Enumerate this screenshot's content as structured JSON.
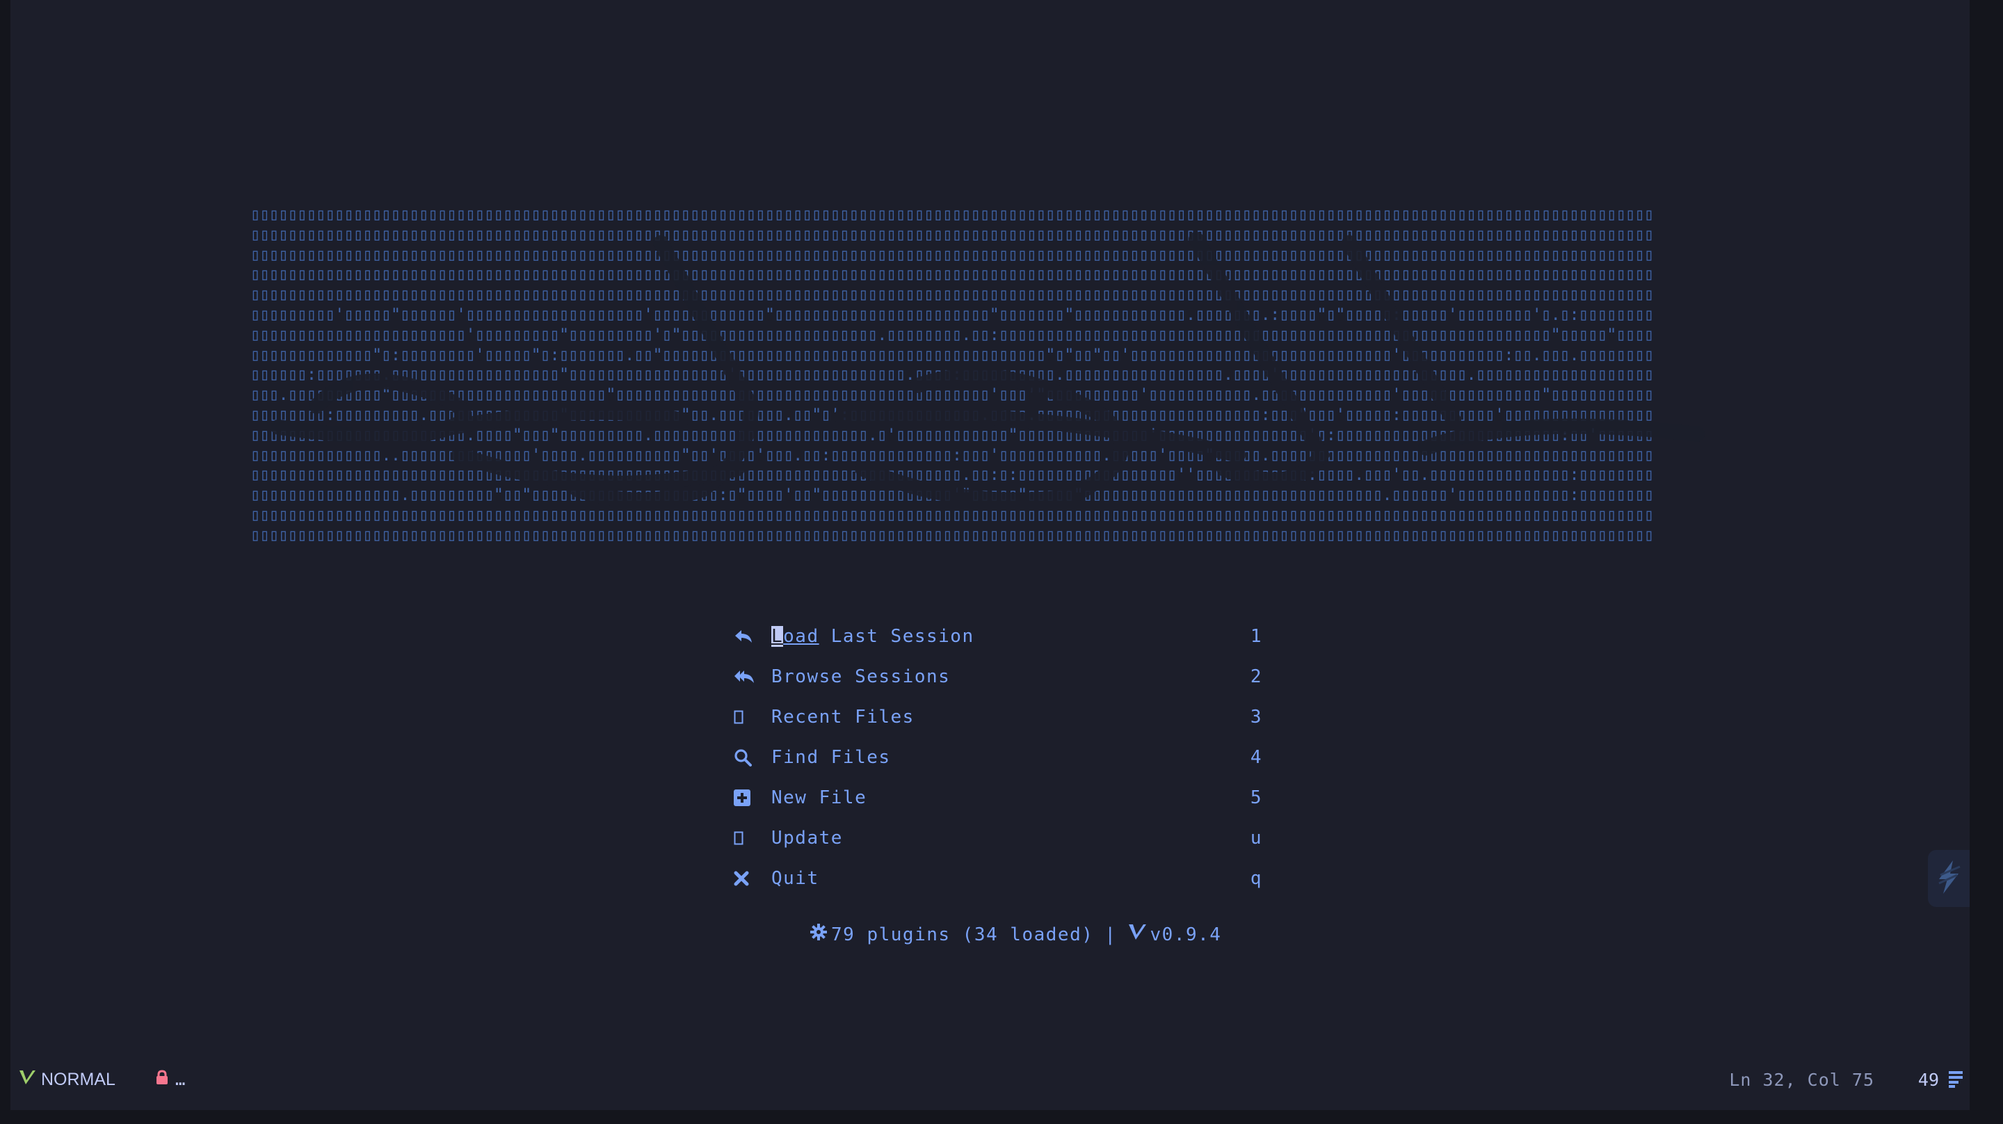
{
  "dashboard": {
    "menu": [
      {
        "icon": "reply-arrow-icon",
        "label_cursor": "L",
        "label_underlined": "oad",
        "label_rest": " Last Session",
        "key": "1"
      },
      {
        "icon": "reply-all-arrow-icon",
        "label": "Browse Sessions",
        "key": "2"
      },
      {
        "icon": "missing-glyph-icon",
        "label": "Recent Files",
        "key": "3"
      },
      {
        "icon": "search-icon",
        "label": "Find Files",
        "key": "4"
      },
      {
        "icon": "plus-square-icon",
        "label": "New File",
        "key": "5"
      },
      {
        "icon": "missing-glyph-icon",
        "label": "Update",
        "key": "u"
      },
      {
        "icon": "close-icon",
        "label": "Quit",
        "key": "q"
      }
    ],
    "footer": {
      "plugins_text": "79 plugins (34 loaded)",
      "separator": "|",
      "version": "v0.9.4"
    }
  },
  "statusline": {
    "mode": "NORMAL",
    "lock_text": "…",
    "position": "Ln 32, Col 75",
    "percent": "49"
  },
  "colors": {
    "background": "#1c1e2a",
    "accent": "#7aa2f7",
    "banner": "#3f63a6",
    "lock": "#f7768e",
    "mode_icon": "#9ece6a"
  }
}
